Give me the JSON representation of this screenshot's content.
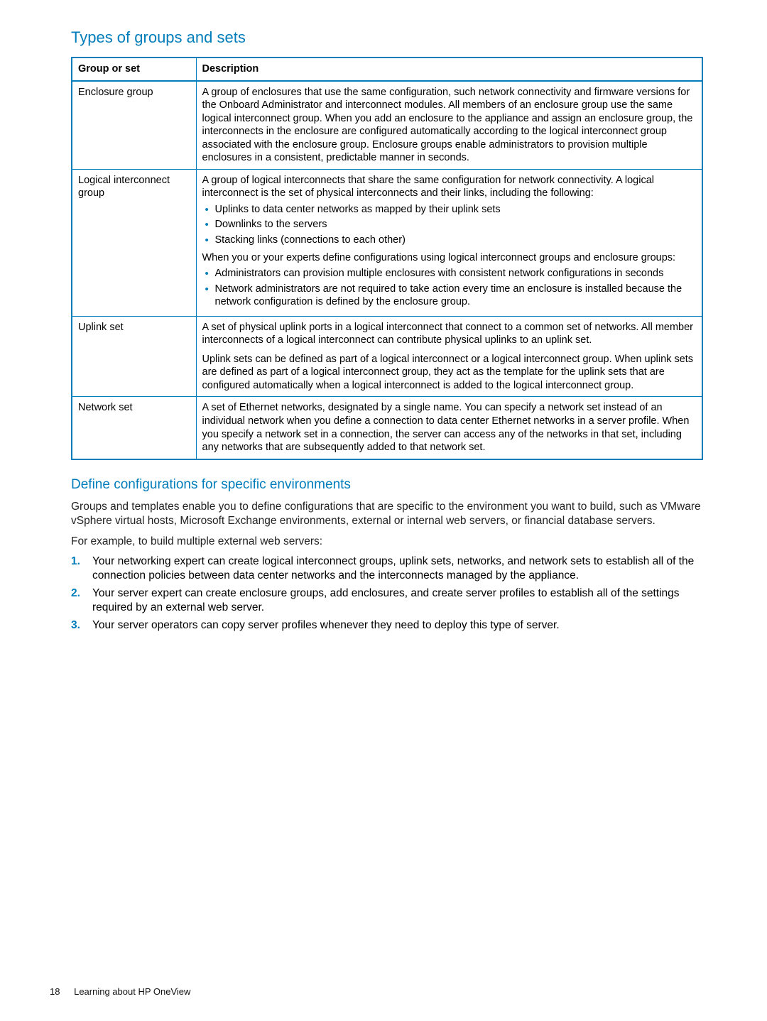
{
  "headings": {
    "types": "Types of groups and sets",
    "define": "Define configurations for specific environments"
  },
  "table": {
    "col1": "Group or set",
    "col2": "Description",
    "rows": {
      "enclosure": {
        "name": "Enclosure group",
        "desc": "A group of enclosures that use the same configuration, such network connectivity and firmware versions for the Onboard Administrator and interconnect modules. All members of an enclosure group use the same logical interconnect group. When you add an enclosure to the appliance and assign an enclosure group, the interconnects in the enclosure are configured automatically according to the logical interconnect group associated with the enclosure group. Enclosure groups enable administrators to provision multiple enclosures in a consistent, predictable manner in seconds."
      },
      "logical": {
        "name": "Logical interconnect group",
        "intro": "A group of logical interconnects that share the same configuration for network connectivity. A logical interconnect is the set of physical interconnects and their links, including the following:",
        "bullets1": {
          "b0": "Uplinks to data center networks as mapped by their uplink sets",
          "b1": "Downlinks to the servers",
          "b2": "Stacking links (connections to each other)"
        },
        "mid": "When you or your experts define configurations using logical interconnect groups and enclosure groups:",
        "bullets2": {
          "b0": "Administrators can provision multiple enclosures with consistent network configurations in seconds",
          "b1": "Network administrators are not required to take action every time an enclosure is installed because the network configuration is defined by the enclosure group."
        }
      },
      "uplink": {
        "name": "Uplink set",
        "p1": "A set of physical uplink ports in a logical interconnect that connect to a common set of networks. All member interconnects of a logical interconnect can contribute physical uplinks to an uplink set.",
        "p2": "Uplink sets can be defined as part of a logical interconnect or a logical interconnect group. When uplink sets are defined as part of a logical interconnect group, they act as the template for the uplink sets that are configured automatically when a logical interconnect is added to the logical interconnect group."
      },
      "network": {
        "name": "Network set",
        "desc": "A set of Ethernet networks, designated by a single name. You can specify a network set instead of an individual network when you define a connection to data center Ethernet networks in a server profile. When you specify a network set in a connection, the server can access any of the networks in that set, including any networks that are subsequently added to that network set."
      }
    }
  },
  "paragraphs": {
    "p1": "Groups and templates enable you to define configurations that are specific to the environment you want to build, such as VMware vSphere virtual hosts, Microsoft Exchange environments, external or internal web servers, or financial database servers.",
    "p2": "For example, to build multiple external web servers:"
  },
  "steps": {
    "s1": "Your networking expert can create logical interconnect groups, uplink sets, networks, and network sets to establish all of the connection policies between data center networks and the interconnects managed by the appliance.",
    "s2": "Your server expert can create enclosure groups, add enclosures, and create server profiles to establish all of the settings required by an external web server.",
    "s3": "Your server operators can copy server profiles whenever they need to deploy this type of server."
  },
  "footer": {
    "page": "18",
    "title": "Learning about HP OneView"
  }
}
